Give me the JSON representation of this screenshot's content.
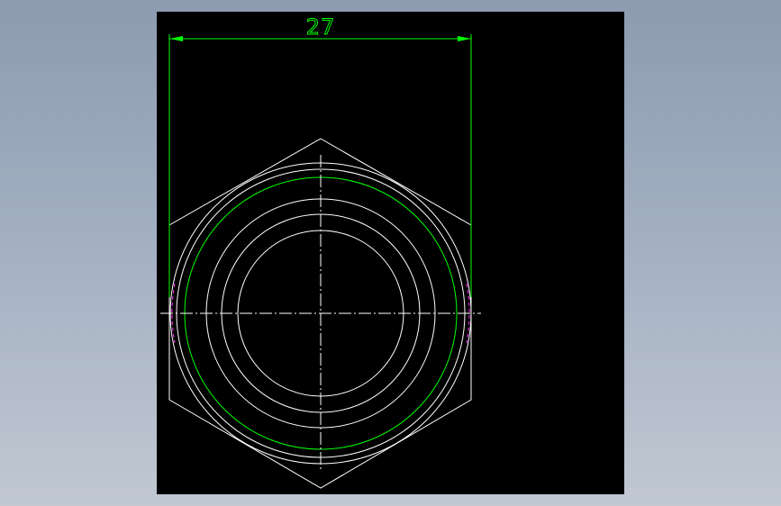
{
  "drawing": {
    "dimension_label": "27"
  },
  "colors": {
    "geometry": "#ffffff",
    "dimension": "#00ff00",
    "thread_arc": "#ff33ff",
    "background": "#000000"
  }
}
